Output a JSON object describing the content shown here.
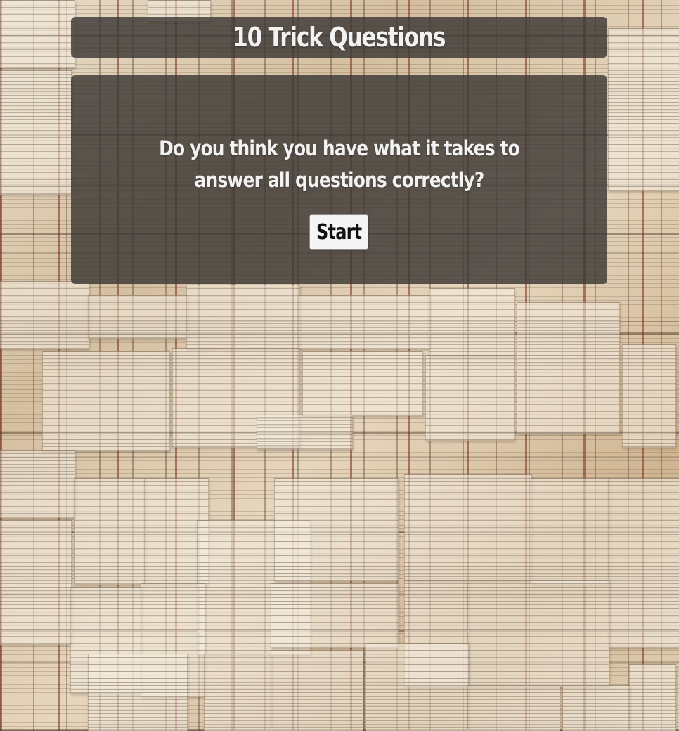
{
  "header": {
    "title": "10 Trick Questions"
  },
  "intro": {
    "question": "Do you think you have what it takes to answer all questions correctly?",
    "start_label": "Start"
  },
  "background": {
    "description_icon": "open-books-wallpaper"
  },
  "colors": {
    "panel_bg": "#3c3836",
    "text": "#f2f2f2",
    "button_bg": "#f5f5f5",
    "button_text": "#111111"
  }
}
